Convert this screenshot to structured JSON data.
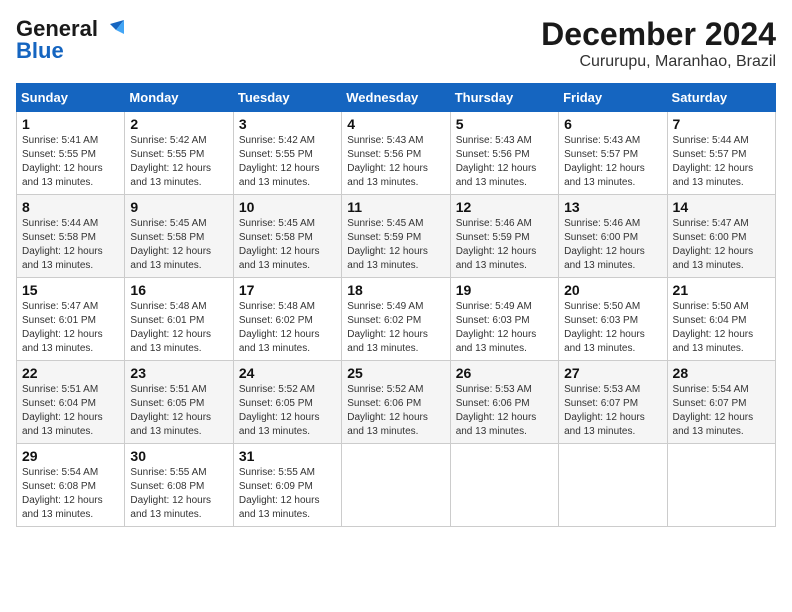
{
  "header": {
    "logo_line1": "General",
    "logo_line2": "Blue",
    "month": "December 2024",
    "location": "Cururupu, Maranhao, Brazil"
  },
  "days_of_week": [
    "Sunday",
    "Monday",
    "Tuesday",
    "Wednesday",
    "Thursday",
    "Friday",
    "Saturday"
  ],
  "weeks": [
    [
      {
        "day": "1",
        "sunrise": "5:41 AM",
        "sunset": "5:55 PM",
        "daylight": "12 hours and 13 minutes."
      },
      {
        "day": "2",
        "sunrise": "5:42 AM",
        "sunset": "5:55 PM",
        "daylight": "12 hours and 13 minutes."
      },
      {
        "day": "3",
        "sunrise": "5:42 AM",
        "sunset": "5:55 PM",
        "daylight": "12 hours and 13 minutes."
      },
      {
        "day": "4",
        "sunrise": "5:43 AM",
        "sunset": "5:56 PM",
        "daylight": "12 hours and 13 minutes."
      },
      {
        "day": "5",
        "sunrise": "5:43 AM",
        "sunset": "5:56 PM",
        "daylight": "12 hours and 13 minutes."
      },
      {
        "day": "6",
        "sunrise": "5:43 AM",
        "sunset": "5:57 PM",
        "daylight": "12 hours and 13 minutes."
      },
      {
        "day": "7",
        "sunrise": "5:44 AM",
        "sunset": "5:57 PM",
        "daylight": "12 hours and 13 minutes."
      }
    ],
    [
      {
        "day": "8",
        "sunrise": "5:44 AM",
        "sunset": "5:58 PM",
        "daylight": "12 hours and 13 minutes."
      },
      {
        "day": "9",
        "sunrise": "5:45 AM",
        "sunset": "5:58 PM",
        "daylight": "12 hours and 13 minutes."
      },
      {
        "day": "10",
        "sunrise": "5:45 AM",
        "sunset": "5:58 PM",
        "daylight": "12 hours and 13 minutes."
      },
      {
        "day": "11",
        "sunrise": "5:45 AM",
        "sunset": "5:59 PM",
        "daylight": "12 hours and 13 minutes."
      },
      {
        "day": "12",
        "sunrise": "5:46 AM",
        "sunset": "5:59 PM",
        "daylight": "12 hours and 13 minutes."
      },
      {
        "day": "13",
        "sunrise": "5:46 AM",
        "sunset": "6:00 PM",
        "daylight": "12 hours and 13 minutes."
      },
      {
        "day": "14",
        "sunrise": "5:47 AM",
        "sunset": "6:00 PM",
        "daylight": "12 hours and 13 minutes."
      }
    ],
    [
      {
        "day": "15",
        "sunrise": "5:47 AM",
        "sunset": "6:01 PM",
        "daylight": "12 hours and 13 minutes."
      },
      {
        "day": "16",
        "sunrise": "5:48 AM",
        "sunset": "6:01 PM",
        "daylight": "12 hours and 13 minutes."
      },
      {
        "day": "17",
        "sunrise": "5:48 AM",
        "sunset": "6:02 PM",
        "daylight": "12 hours and 13 minutes."
      },
      {
        "day": "18",
        "sunrise": "5:49 AM",
        "sunset": "6:02 PM",
        "daylight": "12 hours and 13 minutes."
      },
      {
        "day": "19",
        "sunrise": "5:49 AM",
        "sunset": "6:03 PM",
        "daylight": "12 hours and 13 minutes."
      },
      {
        "day": "20",
        "sunrise": "5:50 AM",
        "sunset": "6:03 PM",
        "daylight": "12 hours and 13 minutes."
      },
      {
        "day": "21",
        "sunrise": "5:50 AM",
        "sunset": "6:04 PM",
        "daylight": "12 hours and 13 minutes."
      }
    ],
    [
      {
        "day": "22",
        "sunrise": "5:51 AM",
        "sunset": "6:04 PM",
        "daylight": "12 hours and 13 minutes."
      },
      {
        "day": "23",
        "sunrise": "5:51 AM",
        "sunset": "6:05 PM",
        "daylight": "12 hours and 13 minutes."
      },
      {
        "day": "24",
        "sunrise": "5:52 AM",
        "sunset": "6:05 PM",
        "daylight": "12 hours and 13 minutes."
      },
      {
        "day": "25",
        "sunrise": "5:52 AM",
        "sunset": "6:06 PM",
        "daylight": "12 hours and 13 minutes."
      },
      {
        "day": "26",
        "sunrise": "5:53 AM",
        "sunset": "6:06 PM",
        "daylight": "12 hours and 13 minutes."
      },
      {
        "day": "27",
        "sunrise": "5:53 AM",
        "sunset": "6:07 PM",
        "daylight": "12 hours and 13 minutes."
      },
      {
        "day": "28",
        "sunrise": "5:54 AM",
        "sunset": "6:07 PM",
        "daylight": "12 hours and 13 minutes."
      }
    ],
    [
      {
        "day": "29",
        "sunrise": "5:54 AM",
        "sunset": "6:08 PM",
        "daylight": "12 hours and 13 minutes."
      },
      {
        "day": "30",
        "sunrise": "5:55 AM",
        "sunset": "6:08 PM",
        "daylight": "12 hours and 13 minutes."
      },
      {
        "day": "31",
        "sunrise": "5:55 AM",
        "sunset": "6:09 PM",
        "daylight": "12 hours and 13 minutes."
      },
      null,
      null,
      null,
      null
    ]
  ],
  "labels": {
    "sunrise": "Sunrise:",
    "sunset": "Sunset:",
    "daylight": "Daylight:"
  }
}
